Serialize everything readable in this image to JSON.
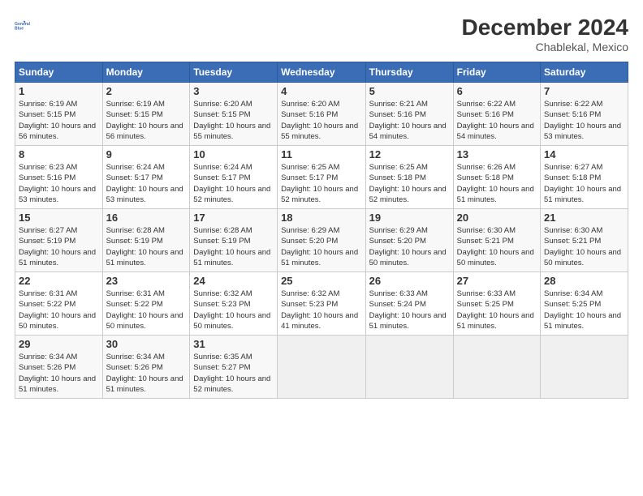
{
  "logo": {
    "line1": "General",
    "line2": "Blue"
  },
  "title": "December 2024",
  "subtitle": "Chablekal, Mexico",
  "header_days": [
    "Sunday",
    "Monday",
    "Tuesday",
    "Wednesday",
    "Thursday",
    "Friday",
    "Saturday"
  ],
  "weeks": [
    [
      {
        "day": "1",
        "sunrise": "6:19 AM",
        "sunset": "5:15 PM",
        "daylight": "10 hours and 56 minutes."
      },
      {
        "day": "2",
        "sunrise": "6:19 AM",
        "sunset": "5:15 PM",
        "daylight": "10 hours and 56 minutes."
      },
      {
        "day": "3",
        "sunrise": "6:20 AM",
        "sunset": "5:15 PM",
        "daylight": "10 hours and 55 minutes."
      },
      {
        "day": "4",
        "sunrise": "6:20 AM",
        "sunset": "5:16 PM",
        "daylight": "10 hours and 55 minutes."
      },
      {
        "day": "5",
        "sunrise": "6:21 AM",
        "sunset": "5:16 PM",
        "daylight": "10 hours and 54 minutes."
      },
      {
        "day": "6",
        "sunrise": "6:22 AM",
        "sunset": "5:16 PM",
        "daylight": "10 hours and 54 minutes."
      },
      {
        "day": "7",
        "sunrise": "6:22 AM",
        "sunset": "5:16 PM",
        "daylight": "10 hours and 53 minutes."
      }
    ],
    [
      {
        "day": "8",
        "sunrise": "6:23 AM",
        "sunset": "5:16 PM",
        "daylight": "10 hours and 53 minutes."
      },
      {
        "day": "9",
        "sunrise": "6:24 AM",
        "sunset": "5:17 PM",
        "daylight": "10 hours and 53 minutes."
      },
      {
        "day": "10",
        "sunrise": "6:24 AM",
        "sunset": "5:17 PM",
        "daylight": "10 hours and 52 minutes."
      },
      {
        "day": "11",
        "sunrise": "6:25 AM",
        "sunset": "5:17 PM",
        "daylight": "10 hours and 52 minutes."
      },
      {
        "day": "12",
        "sunrise": "6:25 AM",
        "sunset": "5:18 PM",
        "daylight": "10 hours and 52 minutes."
      },
      {
        "day": "13",
        "sunrise": "6:26 AM",
        "sunset": "5:18 PM",
        "daylight": "10 hours and 51 minutes."
      },
      {
        "day": "14",
        "sunrise": "6:27 AM",
        "sunset": "5:18 PM",
        "daylight": "10 hours and 51 minutes."
      }
    ],
    [
      {
        "day": "15",
        "sunrise": "6:27 AM",
        "sunset": "5:19 PM",
        "daylight": "10 hours and 51 minutes."
      },
      {
        "day": "16",
        "sunrise": "6:28 AM",
        "sunset": "5:19 PM",
        "daylight": "10 hours and 51 minutes."
      },
      {
        "day": "17",
        "sunrise": "6:28 AM",
        "sunset": "5:19 PM",
        "daylight": "10 hours and 51 minutes."
      },
      {
        "day": "18",
        "sunrise": "6:29 AM",
        "sunset": "5:20 PM",
        "daylight": "10 hours and 51 minutes."
      },
      {
        "day": "19",
        "sunrise": "6:29 AM",
        "sunset": "5:20 PM",
        "daylight": "10 hours and 50 minutes."
      },
      {
        "day": "20",
        "sunrise": "6:30 AM",
        "sunset": "5:21 PM",
        "daylight": "10 hours and 50 minutes."
      },
      {
        "day": "21",
        "sunrise": "6:30 AM",
        "sunset": "5:21 PM",
        "daylight": "10 hours and 50 minutes."
      }
    ],
    [
      {
        "day": "22",
        "sunrise": "6:31 AM",
        "sunset": "5:22 PM",
        "daylight": "10 hours and 50 minutes."
      },
      {
        "day": "23",
        "sunrise": "6:31 AM",
        "sunset": "5:22 PM",
        "daylight": "10 hours and 50 minutes."
      },
      {
        "day": "24",
        "sunrise": "6:32 AM",
        "sunset": "5:23 PM",
        "daylight": "10 hours and 50 minutes."
      },
      {
        "day": "25",
        "sunrise": "6:32 AM",
        "sunset": "5:23 PM",
        "daylight": "10 hours and 41 minutes."
      },
      {
        "day": "26",
        "sunrise": "6:33 AM",
        "sunset": "5:24 PM",
        "daylight": "10 hours and 51 minutes."
      },
      {
        "day": "27",
        "sunrise": "6:33 AM",
        "sunset": "5:25 PM",
        "daylight": "10 hours and 51 minutes."
      },
      {
        "day": "28",
        "sunrise": "6:34 AM",
        "sunset": "5:25 PM",
        "daylight": "10 hours and 51 minutes."
      }
    ],
    [
      {
        "day": "29",
        "sunrise": "6:34 AM",
        "sunset": "5:26 PM",
        "daylight": "10 hours and 51 minutes."
      },
      {
        "day": "30",
        "sunrise": "6:34 AM",
        "sunset": "5:26 PM",
        "daylight": "10 hours and 51 minutes."
      },
      {
        "day": "31",
        "sunrise": "6:35 AM",
        "sunset": "5:27 PM",
        "daylight": "10 hours and 52 minutes."
      },
      null,
      null,
      null,
      null
    ]
  ]
}
